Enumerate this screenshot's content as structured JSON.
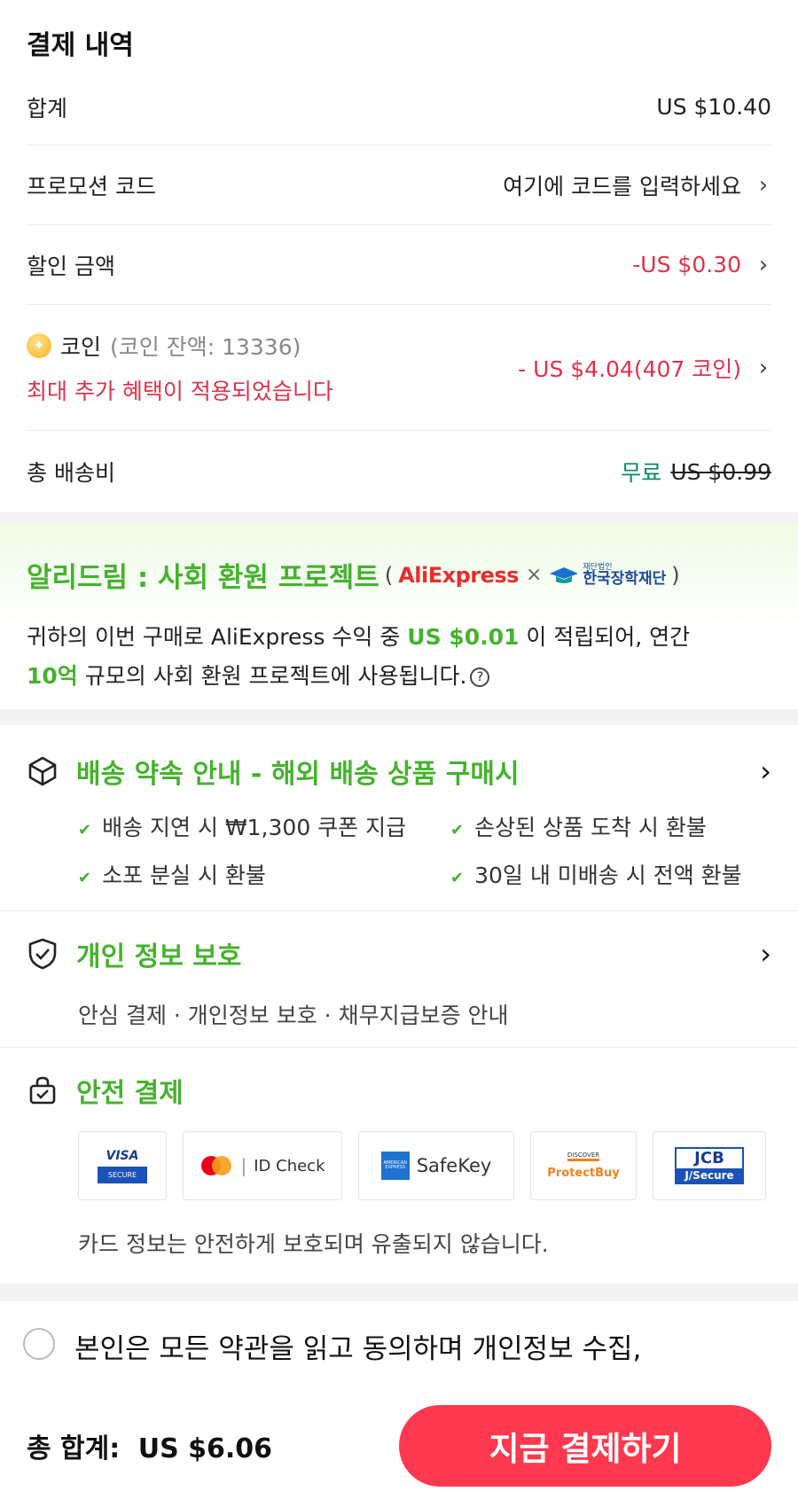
{
  "summary": {
    "title": "결제 내역",
    "subtotal_label": "합계",
    "subtotal_value": "US $10.40",
    "promo_label": "프로모션 코드",
    "promo_placeholder": "여기에 코드를 입력하세요",
    "discount_label": "할인 금액",
    "discount_value": "-US $0.30",
    "coin_label": "코인",
    "coin_balance": "(코인 잔액: 13336)",
    "coin_note": "최대 추가 혜택이 적용되었습니다",
    "coin_value": "- US $4.04(407 코인)",
    "shipping_label": "총 배송비",
    "shipping_free": "무료",
    "shipping_original": "US $0.99"
  },
  "charity": {
    "title": "알리드림 : 사회 환원 프로젝트",
    "paren_open": "(",
    "paren_close": ")",
    "ae_logo": "AliExpress",
    "times": "×",
    "kosaf_small": "재단법인",
    "kosaf_name": "한국장학재단",
    "desc_part1": "귀하의 이번 구매로 AliExpress 수익 중 ",
    "desc_amount": "US $0.01",
    "desc_part2": " 이 적립되어, 연간 ",
    "desc_scale": "10억",
    "desc_part3": " 규모의 사회 환원 프로젝트에 사용됩니다.",
    "help_icon": "?"
  },
  "delivery": {
    "title": "배송 약속 안내 - 해외 배송 상품 구매시",
    "items": [
      "배송 지연 시 ₩1,300 쿠폰 지급",
      "손상된 상품 도착 시 환불",
      "소포 분실 시 환불",
      "30일 내 미배송 시 전액 환불"
    ]
  },
  "privacy": {
    "title": "개인 정보 보호",
    "desc": "안심 결제 · 개인정보 보호 · 채무지급보증 안내"
  },
  "secure": {
    "title": "안전 결제",
    "visa_top": "VISA",
    "visa_bottom": "SECURE",
    "mc_text": "ID Check",
    "amex_text": "SafeKey",
    "amex_badge": "AMERICAN EXPRESS",
    "discover_top": "DISCOVER",
    "discover_text": "ProtectBuy",
    "jcb_top": "JCB",
    "jcb_bottom": "J/Secure",
    "note": "카드 정보는 안전하게 보호되며 유출되지 않습니다."
  },
  "terms": {
    "text": "본인은 모든 약관을 읽고 동의하며 개인정보 수집,"
  },
  "footer": {
    "total_label": "총 합계:",
    "total_value": "US $6.06",
    "pay_button": "지금 결제하기"
  },
  "colors": {
    "accent_green": "#46b22e",
    "price_red": "#e0324a",
    "button_red": "#fd384f"
  }
}
